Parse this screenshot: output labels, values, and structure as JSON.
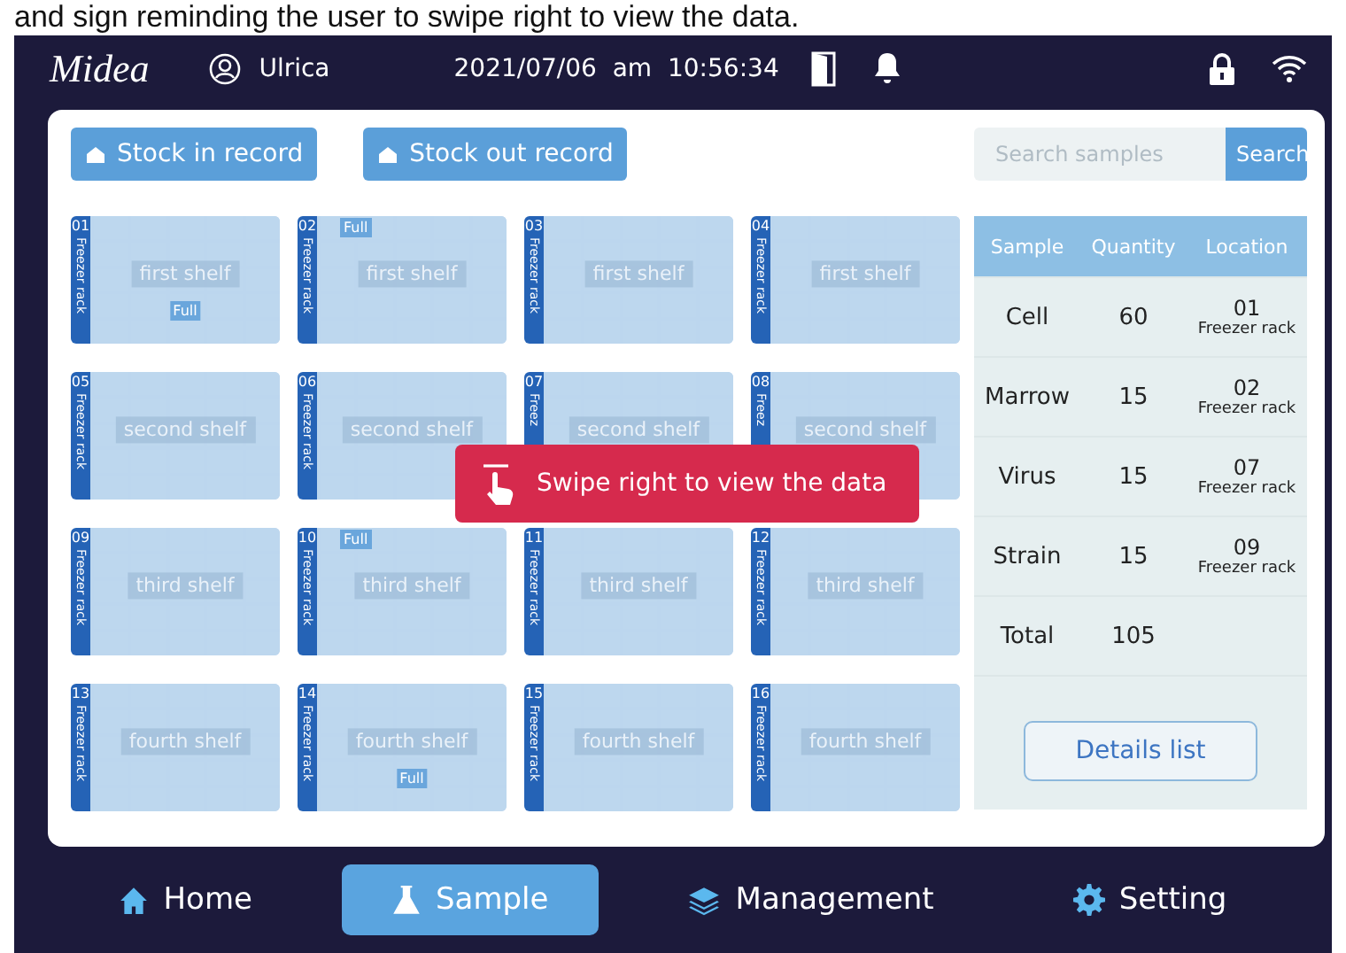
{
  "caption": "and sign reminding the user to swipe right to view the data.",
  "top_bar": {
    "logo": "Midea",
    "user": "Ulrica",
    "datetime": "2021/07/06  am  10:56:34"
  },
  "actions": [
    {
      "label": "Stock in record"
    },
    {
      "label": "Stock out record"
    }
  ],
  "search": {
    "placeholder": "Search samples",
    "button": "Search"
  },
  "racks": [
    {
      "number": "01",
      "side_label": "Freezer rack",
      "shelf": "first shelf",
      "full_badge": {
        "text": "Full",
        "kind": "center"
      }
    },
    {
      "number": "02",
      "side_label": "Freezer rack",
      "shelf": "first shelf",
      "full_badge": {
        "text": "Full",
        "kind": "corner"
      }
    },
    {
      "number": "03",
      "side_label": "Freezer rack",
      "shelf": "first shelf"
    },
    {
      "number": "04",
      "side_label": "Freezer rack",
      "shelf": "first shelf"
    },
    {
      "number": "05",
      "side_label": "Freezer rack",
      "shelf": "second shelf"
    },
    {
      "number": "06",
      "side_label": "Freezer rack",
      "shelf": "second shelf"
    },
    {
      "number": "07",
      "side_label": "Freez",
      "shelf": "second shelf"
    },
    {
      "number": "08",
      "side_label": "Freez",
      "shelf": "second shelf"
    },
    {
      "number": "09",
      "side_label": "Freezer rack",
      "shelf": "third shelf"
    },
    {
      "number": "10",
      "side_label": "Freezer rack",
      "shelf": "third shelf",
      "full_badge": {
        "text": "Full",
        "kind": "corner"
      }
    },
    {
      "number": "11",
      "side_label": "Freezer rack",
      "shelf": "third shelf"
    },
    {
      "number": "12",
      "side_label": "Freezer rack",
      "shelf": "third shelf"
    },
    {
      "number": "13",
      "side_label": "Freezer rack",
      "shelf": "fourth shelf"
    },
    {
      "number": "14",
      "side_label": "Freezer rack",
      "shelf": "fourth shelf",
      "full_badge": {
        "text": "Full",
        "kind": "center"
      }
    },
    {
      "number": "15",
      "side_label": "Freezer rack",
      "shelf": "fourth shelf"
    },
    {
      "number": "16",
      "side_label": "Freezer rack",
      "shelf": "fourth shelf"
    }
  ],
  "toast": {
    "text": "Swipe right to view the data"
  },
  "table": {
    "columns": [
      "Sample",
      "Quantity",
      "Location"
    ],
    "rows": [
      {
        "sample": "Cell",
        "quantity": "60",
        "location": "01",
        "location_sub": "Freezer rack"
      },
      {
        "sample": "Marrow",
        "quantity": "15",
        "location": "02",
        "location_sub": "Freezer rack"
      },
      {
        "sample": "Virus",
        "quantity": "15",
        "location": "07",
        "location_sub": "Freezer rack"
      },
      {
        "sample": "Strain",
        "quantity": "15",
        "location": "09",
        "location_sub": "Freezer rack"
      }
    ],
    "total": {
      "label": "Total",
      "quantity": "105"
    },
    "button": "Details list"
  },
  "nav": [
    {
      "label": "Home",
      "kind": "home",
      "selected": false
    },
    {
      "label": "Sample",
      "kind": "flask",
      "selected": true
    },
    {
      "label": "Management",
      "kind": "layers",
      "selected": false
    },
    {
      "label": "Setting",
      "kind": "gear",
      "selected": false
    }
  ]
}
